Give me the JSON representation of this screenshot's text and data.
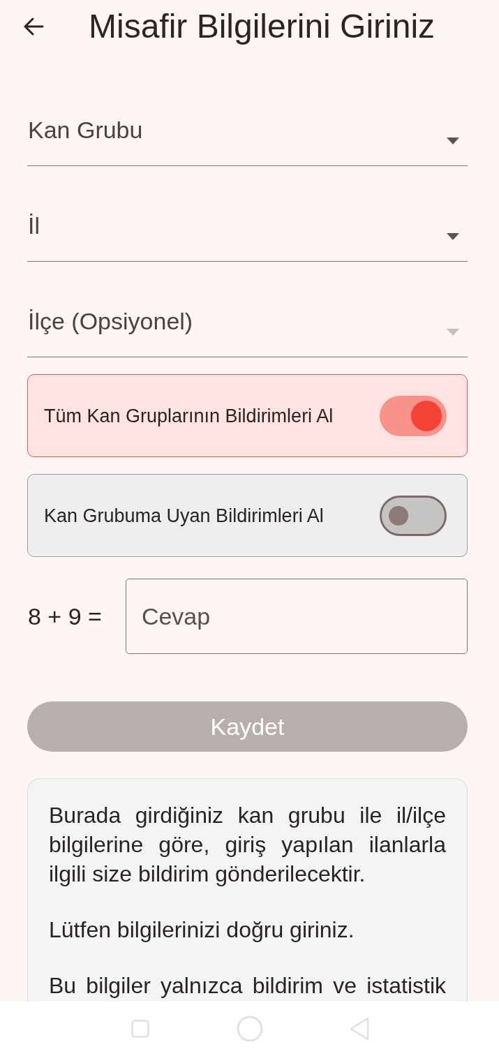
{
  "header": {
    "title": "Misafir Bilgilerini Giriniz"
  },
  "dropdowns": [
    {
      "placeholder": "Kan Grubu",
      "disabled": false
    },
    {
      "placeholder": "İl",
      "disabled": false
    },
    {
      "placeholder": "İlçe (Opsiyonel)",
      "disabled": true
    }
  ],
  "toggles": [
    {
      "label": "Tüm Kan Gruplarının Bildirimleri Al",
      "on": true
    },
    {
      "label": "Kan Grubuma Uyan Bildirimleri Al",
      "on": false
    }
  ],
  "captcha": {
    "question": "8 + 9 =",
    "answer": {
      "placeholder": "Cevap"
    }
  },
  "save_button": {
    "label": "Kaydet",
    "disabled": true
  },
  "info": {
    "paragraphs": [
      "Burada girdiğiniz kan grubu ile il/ilçe bilgilerine göre, giriş yapılan ilanlarla ilgili size bildirim gönderilecektir.",
      "Lütfen bilgilerinizi doğru giriniz.",
      "Bu bilgiler yalnızca bildirim ve istatistik"
    ]
  }
}
